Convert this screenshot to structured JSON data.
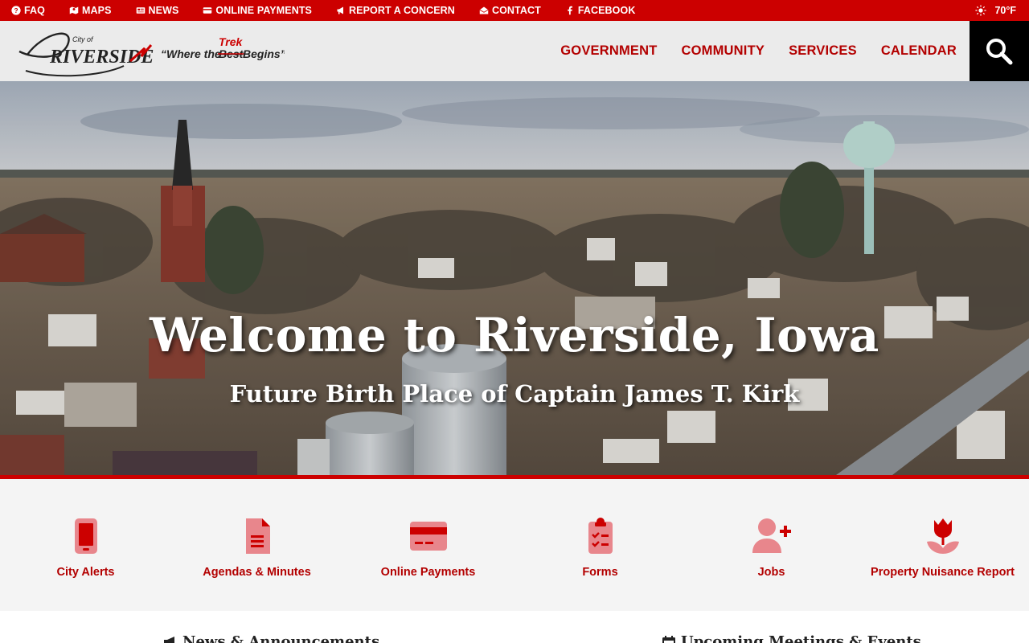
{
  "topbar": {
    "links": [
      {
        "label": "FAQ",
        "icon": "question-circle-icon"
      },
      {
        "label": "MAPS",
        "icon": "map-icon"
      },
      {
        "label": "NEWS",
        "icon": "newspaper-icon"
      },
      {
        "label": "ONLINE PAYMENTS",
        "icon": "credit-card-icon"
      },
      {
        "label": "REPORT A CONCERN",
        "icon": "megaphone-icon"
      },
      {
        "label": "CONTACT",
        "icon": "envelope-open-icon"
      },
      {
        "label": "FACEBOOK",
        "icon": "facebook-icon"
      }
    ],
    "weather": {
      "temp": "70°F",
      "icon": "sun-icon"
    }
  },
  "header": {
    "logo": {
      "city_of": "City of",
      "name": "RIVERSIDE",
      "tagline_start": "“Where the ",
      "tagline_struck": "Best",
      "tagline_inserted": "Trek",
      "tagline_end": " Begins”"
    },
    "nav": [
      "GOVERNMENT",
      "COMMUNITY",
      "SERVICES",
      "CALENDAR"
    ],
    "search_icon": "search-icon"
  },
  "hero": {
    "title": "Welcome to Riverside, Iowa",
    "subtitle": "Future Birth Place of Captain James T. Kirk"
  },
  "quick_links": [
    {
      "label": "City Alerts",
      "icon": "mobile-phone-icon"
    },
    {
      "label": "Agendas & Minutes",
      "icon": "document-icon"
    },
    {
      "label": "Online Payments",
      "icon": "credit-card-icon"
    },
    {
      "label": "Forms",
      "icon": "clipboard-check-icon"
    },
    {
      "label": "Jobs",
      "icon": "user-plus-icon"
    },
    {
      "label": "Property Nuisance Report",
      "icon": "flower-icon"
    }
  ],
  "sections": {
    "news": {
      "title": "News & Announcements",
      "icon": "bullhorn-icon"
    },
    "events": {
      "title": "Upcoming Meetings & Events",
      "icon": "calendar-icon"
    }
  },
  "colors": {
    "brand_red": "#cc0000",
    "nav_red": "#b30000",
    "icon_pink": "#e8868c",
    "header_bg": "#ebebeb",
    "quick_bg": "#f4f4f4"
  }
}
